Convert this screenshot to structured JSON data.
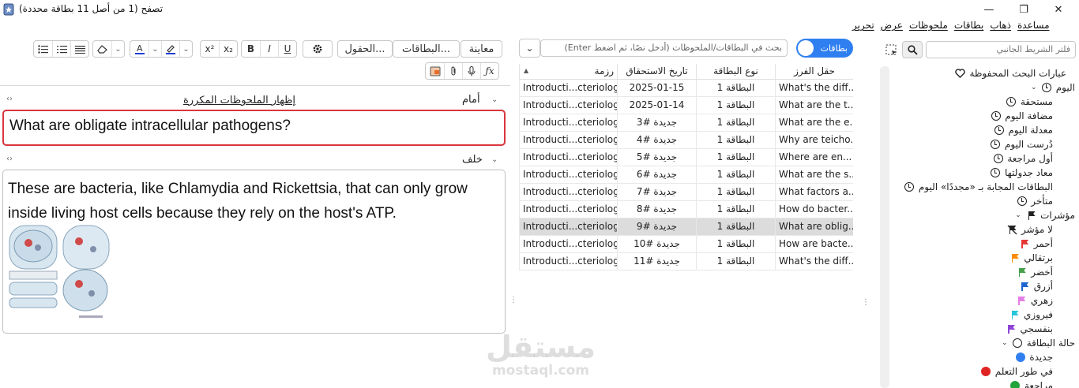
{
  "window": {
    "title": "تصفح (1 من أصل 11 بطاقة محددة)",
    "minimize": "—",
    "maximize": "❐",
    "close": "✕"
  },
  "menu": [
    "تحرير",
    "عرض",
    "ملحوظات",
    "بطاقات",
    "ذهاب",
    "مساعدة"
  ],
  "toolbar": {
    "preview": "معاينة",
    "cards": "البطاقات...",
    "fields": "الحقول...",
    "bold": "B",
    "italic": "I",
    "underline": "U",
    "superscript": "x²",
    "subscript": "x₂",
    "font_color": "#1a3fd6",
    "highlight_color": "#1a3fd6"
  },
  "editor": {
    "front_label": "أمام",
    "dupes_link": "إظهار الملحوظات المكررة",
    "front_text": "What are obligate intracellular pathogens?",
    "back_label": "خلف",
    "back_text": "These are bacteria, like Chlamydia and Rickettsia, that can only grow inside living host cells because they rely on the host's ATP."
  },
  "browser": {
    "toggle_label": "بطاقات",
    "search_placeholder": "بحث في البطاقات/الملحوظات (أدخل نصًا، ثم اضغط Enter)",
    "columns": {
      "sort_field": "حقل الفرز",
      "card_type": "نوع البطاقة",
      "due": "تاريخ الاستحقاق",
      "deck": "رزمة"
    },
    "rows": [
      {
        "sort": "What's the diff...",
        "type": "البطاقة 1",
        "due": "2025-01-15",
        "deck": "Introducti...cteriology",
        "selected": false
      },
      {
        "sort": "What are the t...",
        "type": "البطاقة 1",
        "due": "2025-01-14",
        "deck": "Introducti...cteriology",
        "selected": false
      },
      {
        "sort": "What are the e...",
        "type": "البطاقة 1",
        "due": "جديدة #3",
        "deck": "Introducti...cteriology",
        "selected": false
      },
      {
        "sort": "Why are teicho...",
        "type": "البطاقة 1",
        "due": "جديدة #4",
        "deck": "Introducti...cteriology",
        "selected": false
      },
      {
        "sort": "Where are en...",
        "type": "البطاقة 1",
        "due": "جديدة #5",
        "deck": "Introducti...cteriology",
        "selected": false
      },
      {
        "sort": "What are the s...",
        "type": "البطاقة 1",
        "due": "جديدة #6",
        "deck": "Introducti...cteriology",
        "selected": false
      },
      {
        "sort": "What factors a...",
        "type": "البطاقة 1",
        "due": "جديدة #7",
        "deck": "Introducti...cteriology",
        "selected": false
      },
      {
        "sort": "How do bacter...",
        "type": "البطاقة 1",
        "due": "جديدة #8",
        "deck": "Introducti...cteriology",
        "selected": false
      },
      {
        "sort": "What are oblig...",
        "type": "البطاقة 1",
        "due": "جديدة #9",
        "deck": "Introducti...cteriology",
        "selected": true
      },
      {
        "sort": "How are bacte...",
        "type": "البطاقة 1",
        "due": "جديدة #10",
        "deck": "Introducti...cteriology",
        "selected": false
      },
      {
        "sort": "What's the diff...",
        "type": "البطاقة 1",
        "due": "جديدة #11",
        "deck": "Introducti...cteriology",
        "selected": false
      }
    ]
  },
  "sidebar": {
    "filter_placeholder": "فلتر الشريط الجانبي",
    "saved_searches": "عبارات البحث المحفوظة",
    "today": "اليوم",
    "today_items": [
      "مستحقة",
      "مضافة اليوم",
      "معدلة اليوم",
      "دُرست اليوم",
      "أول مراجعة",
      "معاد جدولتها",
      "البطاقات المجابة بـ «مجددًا» اليوم",
      "متأخر"
    ],
    "flags": "مؤشرات",
    "flag_items": [
      {
        "label": "لا مؤشر",
        "color": "#222222"
      },
      {
        "label": "أحمر",
        "color": "#e53935"
      },
      {
        "label": "برتقالي",
        "color": "#fb8c00"
      },
      {
        "label": "أخضر",
        "color": "#43a047"
      },
      {
        "label": "أزرق",
        "color": "#1e66d0"
      },
      {
        "label": "زهري",
        "color": "#e57ee6"
      },
      {
        "label": "فيروزي",
        "color": "#26c6da"
      },
      {
        "label": "بنفسجي",
        "color": "#8e44d6"
      }
    ],
    "card_state": "حالة البطاقة",
    "state_items": [
      {
        "label": "جديدة",
        "color": "#2f7ff0"
      },
      {
        "label": "في طور التعلم",
        "color": "#e02424"
      },
      {
        "label": "مراجعة",
        "color": "#22a33b"
      }
    ]
  },
  "watermark": {
    "brand": "مستقل",
    "domain": "mostaql.com"
  }
}
